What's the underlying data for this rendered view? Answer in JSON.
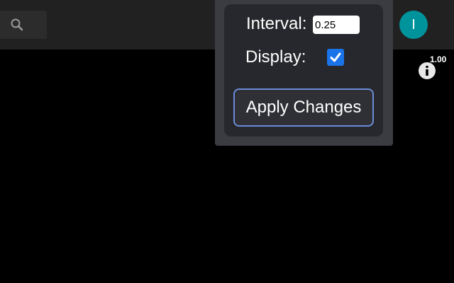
{
  "topbar": {
    "search_icon": "search-icon",
    "avatar_initial": "I",
    "avatar_color": "#00939b"
  },
  "zoom_readout": "1.00",
  "info_icon": "info-icon",
  "settings_panel": {
    "interval_label": "Interval:",
    "interval_value": "0.25",
    "display_label": "Display:",
    "display_checked": true,
    "apply_label": "Apply Changes",
    "accent_color": "#1a73e8"
  }
}
